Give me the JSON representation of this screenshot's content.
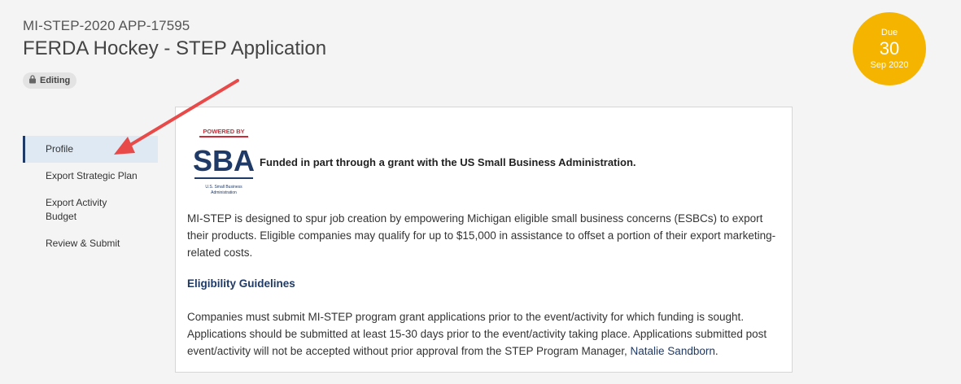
{
  "header": {
    "app_id": "MI-STEP-2020 APP-17595",
    "title": "FERDA Hockey - STEP Application",
    "badge": "Editing"
  },
  "due": {
    "label": "Due",
    "day": "30",
    "month": "Sep 2020",
    "color": "#f4b400"
  },
  "nav": {
    "items": [
      {
        "label": "Profile",
        "active": true
      },
      {
        "label": "Export Strategic Plan"
      },
      {
        "label": "Export Activity Budget"
      },
      {
        "label": "Review & Submit"
      }
    ]
  },
  "content": {
    "logo": {
      "top": "POWERED BY",
      "mark": "SBA",
      "bottom_1": "U.S. Small Business",
      "bottom_2": "Administration"
    },
    "funded": "Funded in part through a grant with the US Small Business Administration.",
    "intro": "MI-STEP is designed to spur job creation by empowering Michigan eligible small business concerns (ESBCs) to export their products. Eligible companies may qualify for up to $15,000 in assistance to offset a portion of their export marketing-related costs.",
    "eligibility_heading": "Eligibility Guidelines",
    "eligibility_text": "Companies must submit MI-STEP program grant applications prior to the event/activity for which funding is sought. Applications should be submitted at least 15-30 days prior to the event/activity taking place. Applications submitted post event/activity will not be accepted without prior approval from the STEP Program Manager,",
    "contact_link": "Natalie Sandborn",
    "contact_suffix": "."
  },
  "colors": {
    "accent": "#1f3a66",
    "annotation": "#e84a4a"
  }
}
